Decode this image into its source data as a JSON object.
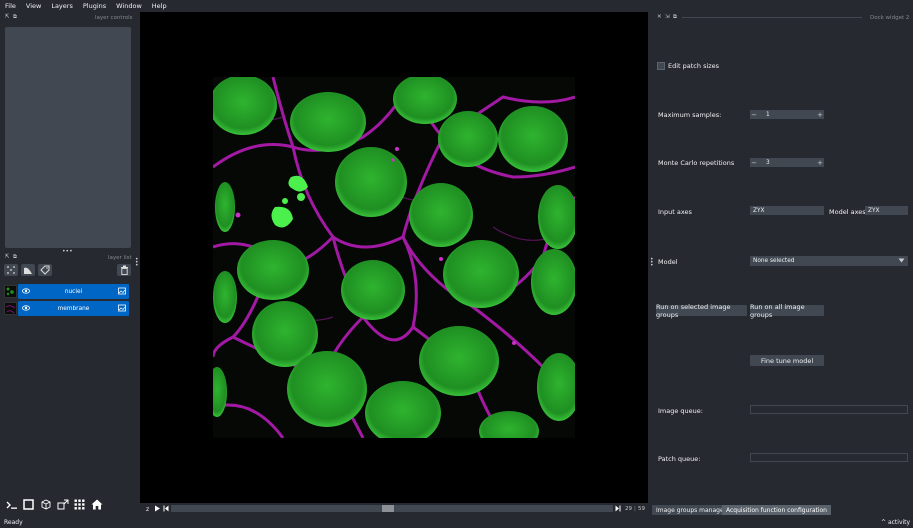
{
  "menu": [
    "File",
    "View",
    "Layers",
    "Plugins",
    "Window",
    "Help"
  ],
  "left_panel": {
    "layer_controls_title": "layer controls",
    "layer_list_title": "layer list",
    "layers": [
      {
        "name": "nuclei",
        "visible": true
      },
      {
        "name": "membrane",
        "visible": true
      }
    ]
  },
  "dims": {
    "axis_label": "z",
    "current": "29",
    "total": "59",
    "slider_position": 0.49
  },
  "dock": {
    "title": "Dock widget 2",
    "edit_patch_sizes_label": "Edit patch sizes",
    "edit_patch_sizes_checked": false,
    "max_samples_label": "Maximum samples:",
    "max_samples_value": "1",
    "mc_repetitions_label": "Monte Carlo repetitions",
    "mc_repetitions_value": "3",
    "input_axes_label": "Input axes",
    "input_axes_value": "ZYX",
    "model_axes_label": "Model axes",
    "model_axes_value": "ZYX",
    "model_label": "Model",
    "model_value": "None selected",
    "run_selected_label": "Run on selected image groups",
    "run_all_label": "Run on all image groups",
    "fine_tune_label": "Fine tune model",
    "image_queue_label": "Image queue:",
    "patch_queue_label": "Patch queue:",
    "tabs": [
      "Image groups manager",
      "Acquisition function configuration"
    ],
    "active_tab": 1
  },
  "status": {
    "text": "Ready",
    "activity_label": "activity"
  },
  "colors": {
    "bg": "#262930",
    "panel": "#414851",
    "accent": "#0066c5",
    "nuclei": "#28c428",
    "membrane": "#c020c0"
  }
}
